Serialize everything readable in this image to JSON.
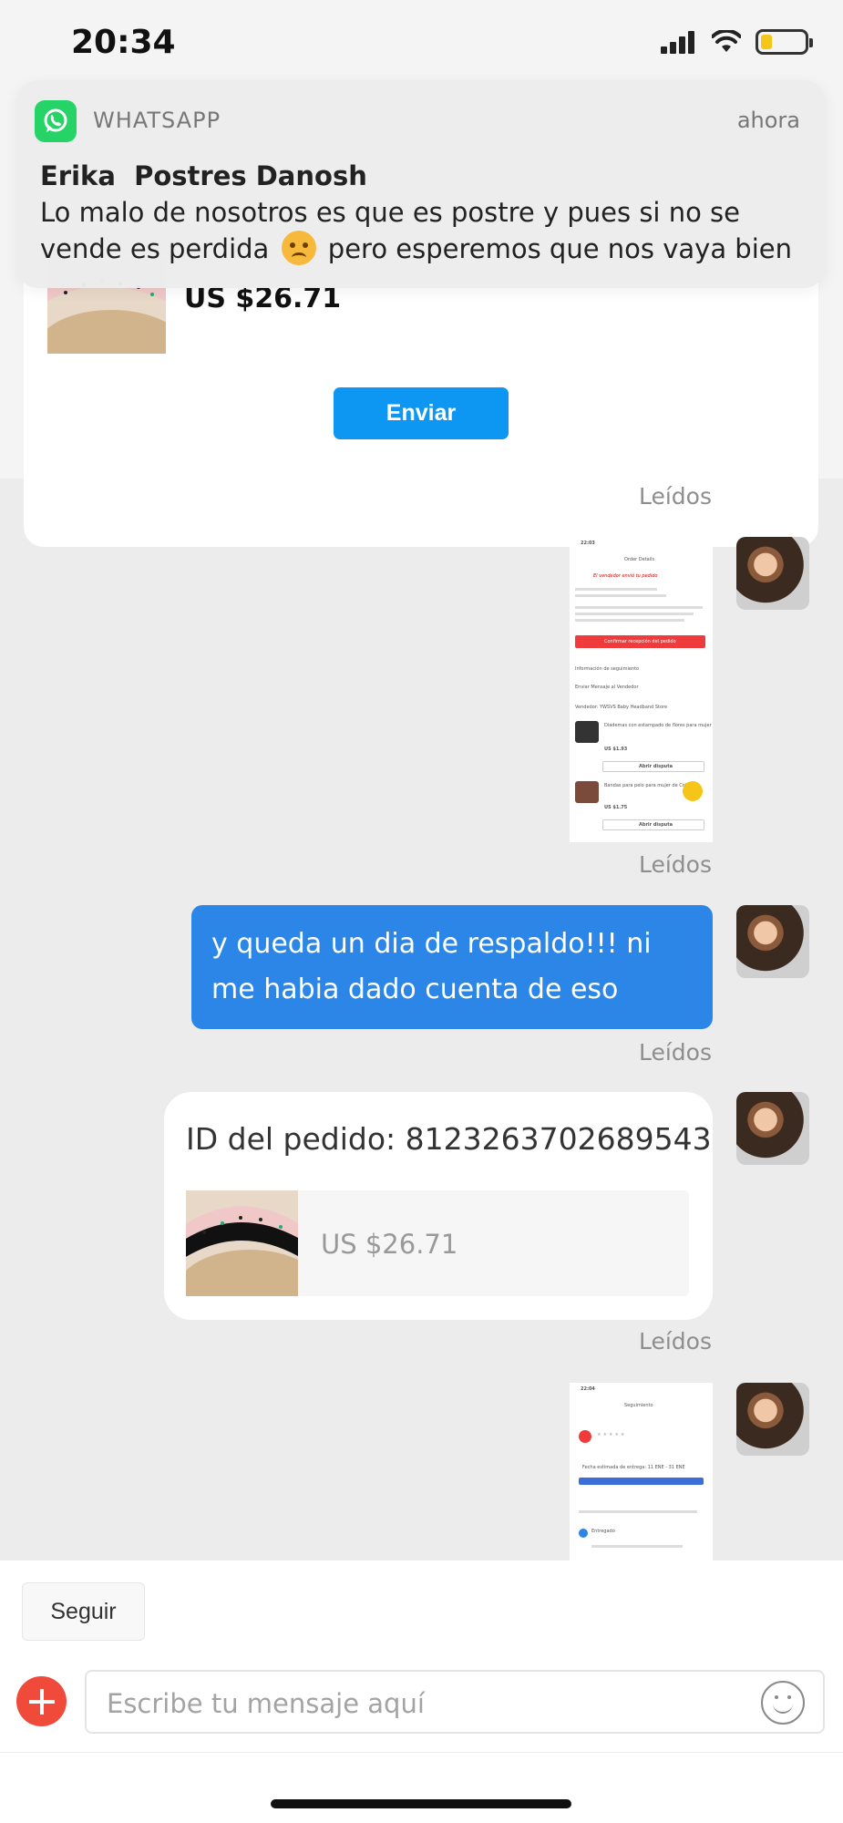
{
  "status_bar": {
    "time": "20:34",
    "battery_level": 0.25
  },
  "notification": {
    "app": "WHATSAPP",
    "time": "ahora",
    "sender": "Erika  Postres Danosh",
    "body_before_emoji": "Lo malo de nosotros es que es postre y pues si no se vende es perdida",
    "emoji": "persevering-face",
    "body_after_emoji": " pero esperemos que nos vaya bien"
  },
  "order_card": {
    "price": "US $26.71",
    "send_label": "Enviar"
  },
  "chat": {
    "read_label": "Leídos",
    "messages": [
      {
        "type": "image",
        "name": "order-details-screenshot"
      },
      {
        "type": "text",
        "text": "y queda un dia de respaldo!!!  ni me habia dado cuenta de eso"
      },
      {
        "type": "order",
        "order_id": "ID del pedido: 8123263702689543",
        "price": "US $26.71"
      },
      {
        "type": "image",
        "name": "tracking-screenshot"
      }
    ]
  },
  "screenshot_1": {
    "time": "22:03",
    "title": "Order Details",
    "status": "El vendedor envió tu pedido",
    "confirm": "Confirmar recepción del pedido",
    "tracking": "Información de seguimiento",
    "message": "Enviar Mensaje al Vendedor",
    "seller": "Vendedor: YWSVS Baby Headband Store",
    "item1": "Diademas con estampado de flores para mujer",
    "price1": "US $1.93",
    "dispute": "Abrir disputa",
    "item2": "Bandas para pelo para mujer de Color",
    "price2": "US $1.75"
  },
  "screenshot_2": {
    "time": "22:04",
    "title": "Seguimiento",
    "estimate": "Fecha estimada de entrega: 11 ENE - 31 ENE",
    "delivered": "Entregado"
  },
  "bottom_bar": {
    "follow_label": "Seguir",
    "input_placeholder": "Escribe tu mensaje aquí"
  },
  "colors": {
    "accent_blue": "#0d96f2",
    "bubble_blue": "#2b86e8",
    "whatsapp_green": "#25d366",
    "add_button_red": "#f04a3a",
    "confirm_red": "#ef3b3b"
  }
}
